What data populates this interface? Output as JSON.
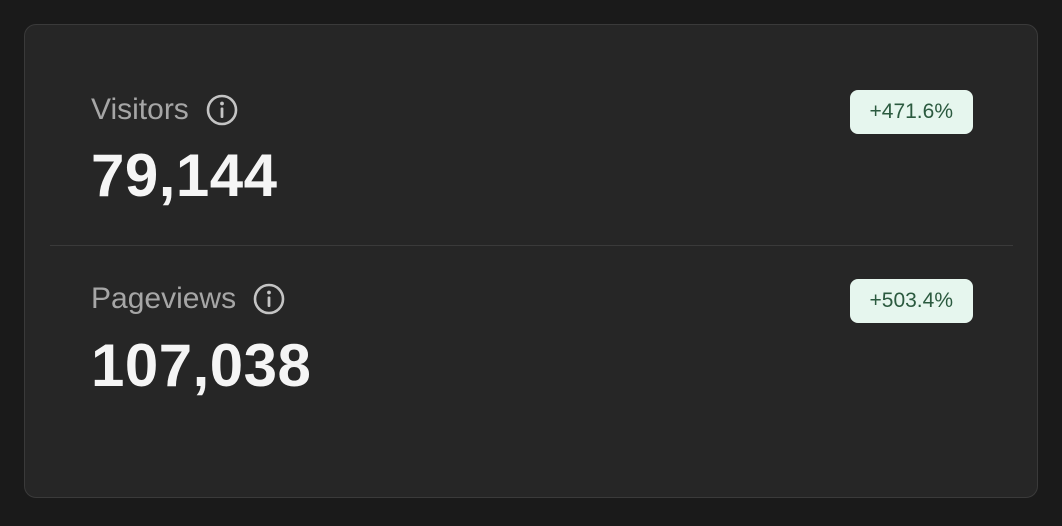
{
  "stats": {
    "visitors": {
      "label": "Visitors",
      "value": "79,144",
      "change": "+471.6%",
      "info_icon": "info-circle-icon"
    },
    "pageviews": {
      "label": "Pageviews",
      "value": "107,038",
      "change": "+503.4%",
      "info_icon": "info-circle-icon"
    }
  },
  "colors": {
    "card_background": "#262626",
    "badge_background": "#e6f6ee",
    "badge_text": "#2b5a3f",
    "label_text": "#a6a6a6",
    "value_text": "#f5f5f5"
  }
}
